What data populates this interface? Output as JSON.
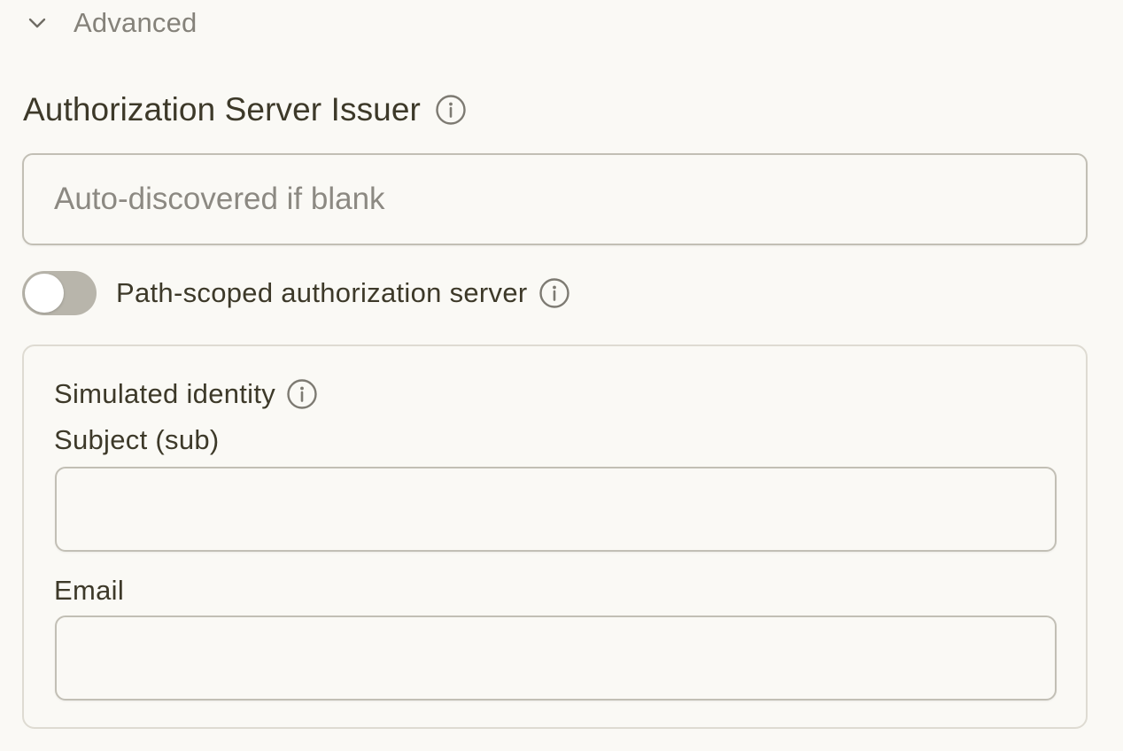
{
  "advanced": {
    "label": "Advanced",
    "icon": "chevron-down-icon",
    "expanded": true
  },
  "issuer": {
    "label": "Authorization Server Issuer",
    "info_icon": "info-icon",
    "placeholder": "Auto-discovered if blank",
    "value": ""
  },
  "path_scoped": {
    "label": "Path-scoped authorization server",
    "enabled": false,
    "info_icon": "info-icon"
  },
  "simulated_identity": {
    "title": "Simulated identity",
    "info_icon": "info-icon",
    "subject": {
      "label": "Subject (sub)",
      "value": ""
    },
    "email": {
      "label": "Email",
      "value": ""
    }
  },
  "colors": {
    "background": "#faf9f5",
    "text": "#3d3929",
    "muted_text": "#85827a",
    "input_border": "#c2bfb5",
    "card_border": "#dedbd2",
    "toggle_off": "#b8b5ab"
  }
}
